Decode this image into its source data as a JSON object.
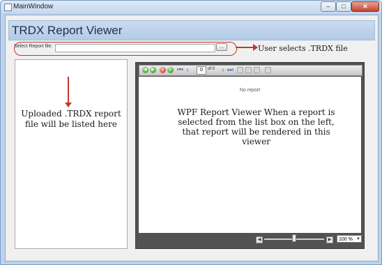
{
  "window": {
    "title": "MainWindow",
    "minimize": "–",
    "maximize": "□",
    "close": "✕"
  },
  "header": {
    "title": "TRDX Report Viewer"
  },
  "file_select": {
    "label": "Select Report file:",
    "value": "",
    "browse_label": "..."
  },
  "annotations": {
    "file": "User selects .TRDX file",
    "list": "Uploaded .TRDX report file will be listed here",
    "viewer": "WPF Report Viewer When a report is selected from the list box on the left, that report will be rendered in this viewer"
  },
  "viewer": {
    "page_number": "0",
    "page_of": "of 0",
    "placeholder": "No report",
    "zoom": "100 %",
    "zoom_level_percent": 100
  },
  "colors": {
    "annotation_red": "#c0392b",
    "header_blue": "#bdd3ec"
  }
}
